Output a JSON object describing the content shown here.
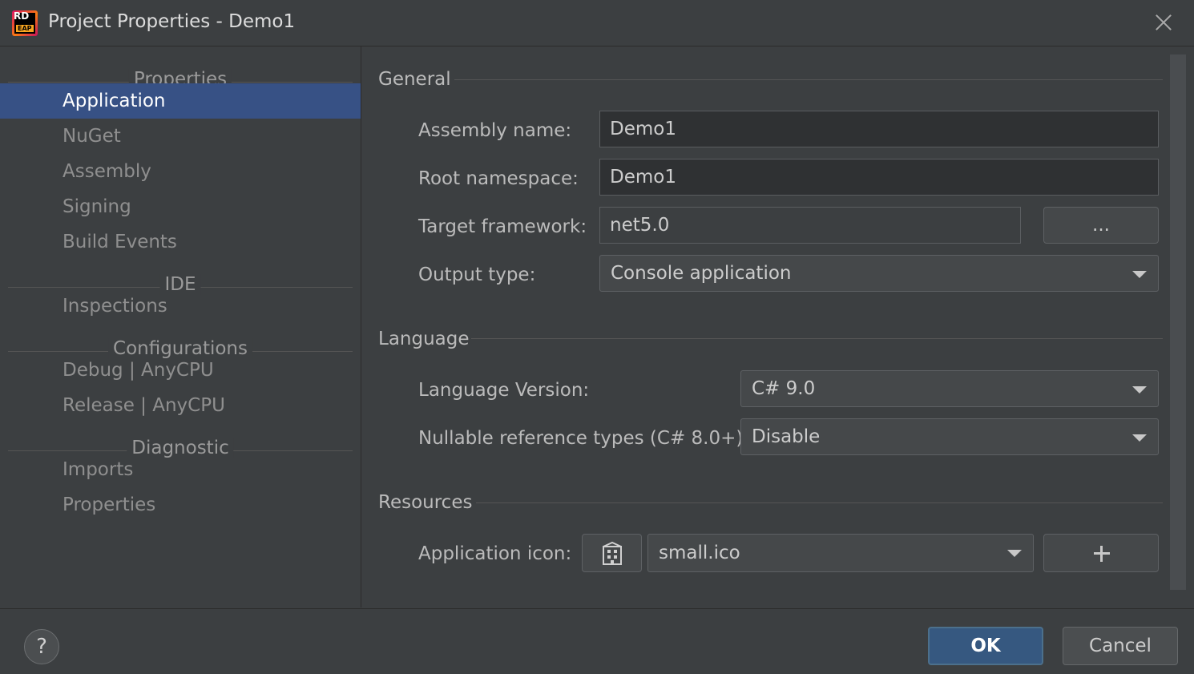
{
  "window": {
    "title": "Project Properties - Demo1",
    "logo_text_top": "RD",
    "logo_text_bottom": "EAP"
  },
  "sidebar": {
    "sections": [
      {
        "label": "Properties",
        "items": [
          "Application",
          "NuGet",
          "Assembly",
          "Signing",
          "Build Events"
        ]
      },
      {
        "label": "IDE",
        "items": [
          "Inspections"
        ]
      },
      {
        "label": "Configurations",
        "items": [
          "Debug | AnyCPU",
          "Release | AnyCPU"
        ]
      },
      {
        "label": "Diagnostic",
        "items": [
          "Imports",
          "Properties"
        ]
      }
    ],
    "active_item": "Application"
  },
  "general": {
    "header": "General",
    "assembly_name_label": "Assembly name:",
    "assembly_name_value": "Demo1",
    "root_namespace_label": "Root namespace:",
    "root_namespace_value": "Demo1",
    "target_framework_label": "Target framework:",
    "target_framework_value": "net5.0",
    "browse_label": "...",
    "output_type_label": "Output type:",
    "output_type_value": "Console application"
  },
  "language": {
    "header": "Language",
    "version_label": "Language Version:",
    "version_value": "C# 9.0",
    "nullable_label": "Nullable reference types (C# 8.0+):",
    "nullable_value": "Disable"
  },
  "resources": {
    "header": "Resources",
    "app_icon_label": "Application icon:",
    "app_icon_value": "small.ico",
    "icon_glyph": "application-icon"
  },
  "footer": {
    "help_label": "?",
    "ok_label": "OK",
    "cancel_label": "Cancel"
  },
  "colors": {
    "background": "#3c3f41",
    "selection": "#375185",
    "ok_button": "#365880"
  }
}
